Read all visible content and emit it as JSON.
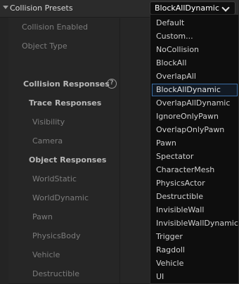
{
  "header": {
    "label": "Collision Presets",
    "selected_preset": "BlockAllDynamic"
  },
  "rows": [
    {
      "label": "Collision Enabled",
      "bold": false
    },
    {
      "label": "Object Type",
      "bold": false
    },
    {
      "label": "",
      "bold": false
    },
    {
      "label": "Collision Responses",
      "bold": true
    },
    {
      "label": "Trace Responses",
      "bold": true
    },
    {
      "label": "Visibility",
      "bold": false
    },
    {
      "label": "Camera",
      "bold": false
    },
    {
      "label": "Object Responses",
      "bold": true
    },
    {
      "label": "WorldStatic",
      "bold": false
    },
    {
      "label": "WorldDynamic",
      "bold": false
    },
    {
      "label": "Pawn",
      "bold": false
    },
    {
      "label": "PhysicsBody",
      "bold": false
    },
    {
      "label": "Vehicle",
      "bold": false
    },
    {
      "label": "Destructible",
      "bold": false
    }
  ],
  "help_icon": {
    "glyph": "?"
  },
  "dropdown": {
    "options": [
      "Default",
      "Custom...",
      "NoCollision",
      "BlockAll",
      "OverlapAll",
      "BlockAllDynamic",
      "OverlapAllDynamic",
      "IgnoreOnlyPawn",
      "OverlapOnlyPawn",
      "Pawn",
      "Spectator",
      "CharacterMesh",
      "PhysicsActor",
      "Destructible",
      "InvisibleWall",
      "InvisibleWallDynamic",
      "Trigger",
      "Ragdoll",
      "Vehicle",
      "UI"
    ],
    "selected": "BlockAllDynamic"
  }
}
